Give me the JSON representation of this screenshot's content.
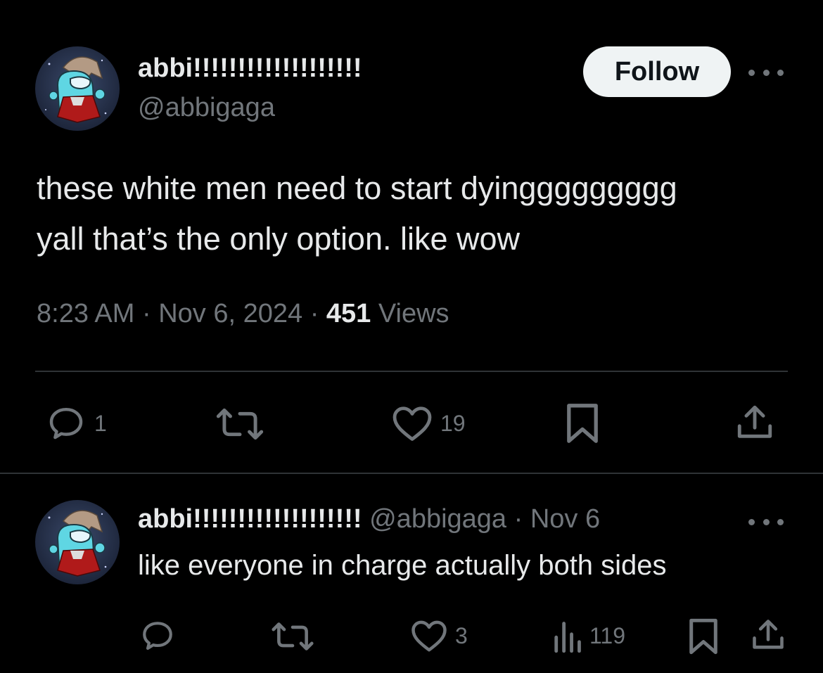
{
  "tweet": {
    "author_name": "abbi!!!!!!!!!!!!!!!!!!!",
    "author_handle": "@abbigaga",
    "follow_label": "Follow",
    "text_line_1": "these white men need to start dyinggggggggg",
    "text_line_2": "yall that’s the only option. like wow",
    "time": "8:23 AM",
    "separator": "·",
    "date": "Nov 6, 2024",
    "views_count": "451",
    "views_label": "Views",
    "actions": {
      "reply_count": "1",
      "like_count": "19"
    }
  },
  "reply": {
    "author_name": "abbi!!!!!!!!!!!!!!!!!!!",
    "author_handle": "@abbigaga",
    "separator": "·",
    "date": "Nov 6",
    "text": "like everyone in charge actually both sides",
    "actions": {
      "like_count": "3",
      "views_count": "119"
    }
  },
  "colors": {
    "background": "#000000",
    "primary_text": "#e7e9ea",
    "secondary_text": "#71767b",
    "divider": "#2f3336",
    "follow_bg": "#eff3f4"
  },
  "icons": {
    "avatar": "among-us-crewmate-avatar",
    "more": "more-horizontal-icon",
    "reply": "reply-bubble-icon",
    "retweet": "retweet-icon",
    "like": "heart-icon",
    "bookmark": "bookmark-icon",
    "share": "share-upload-icon",
    "views": "views-bar-chart-icon"
  }
}
